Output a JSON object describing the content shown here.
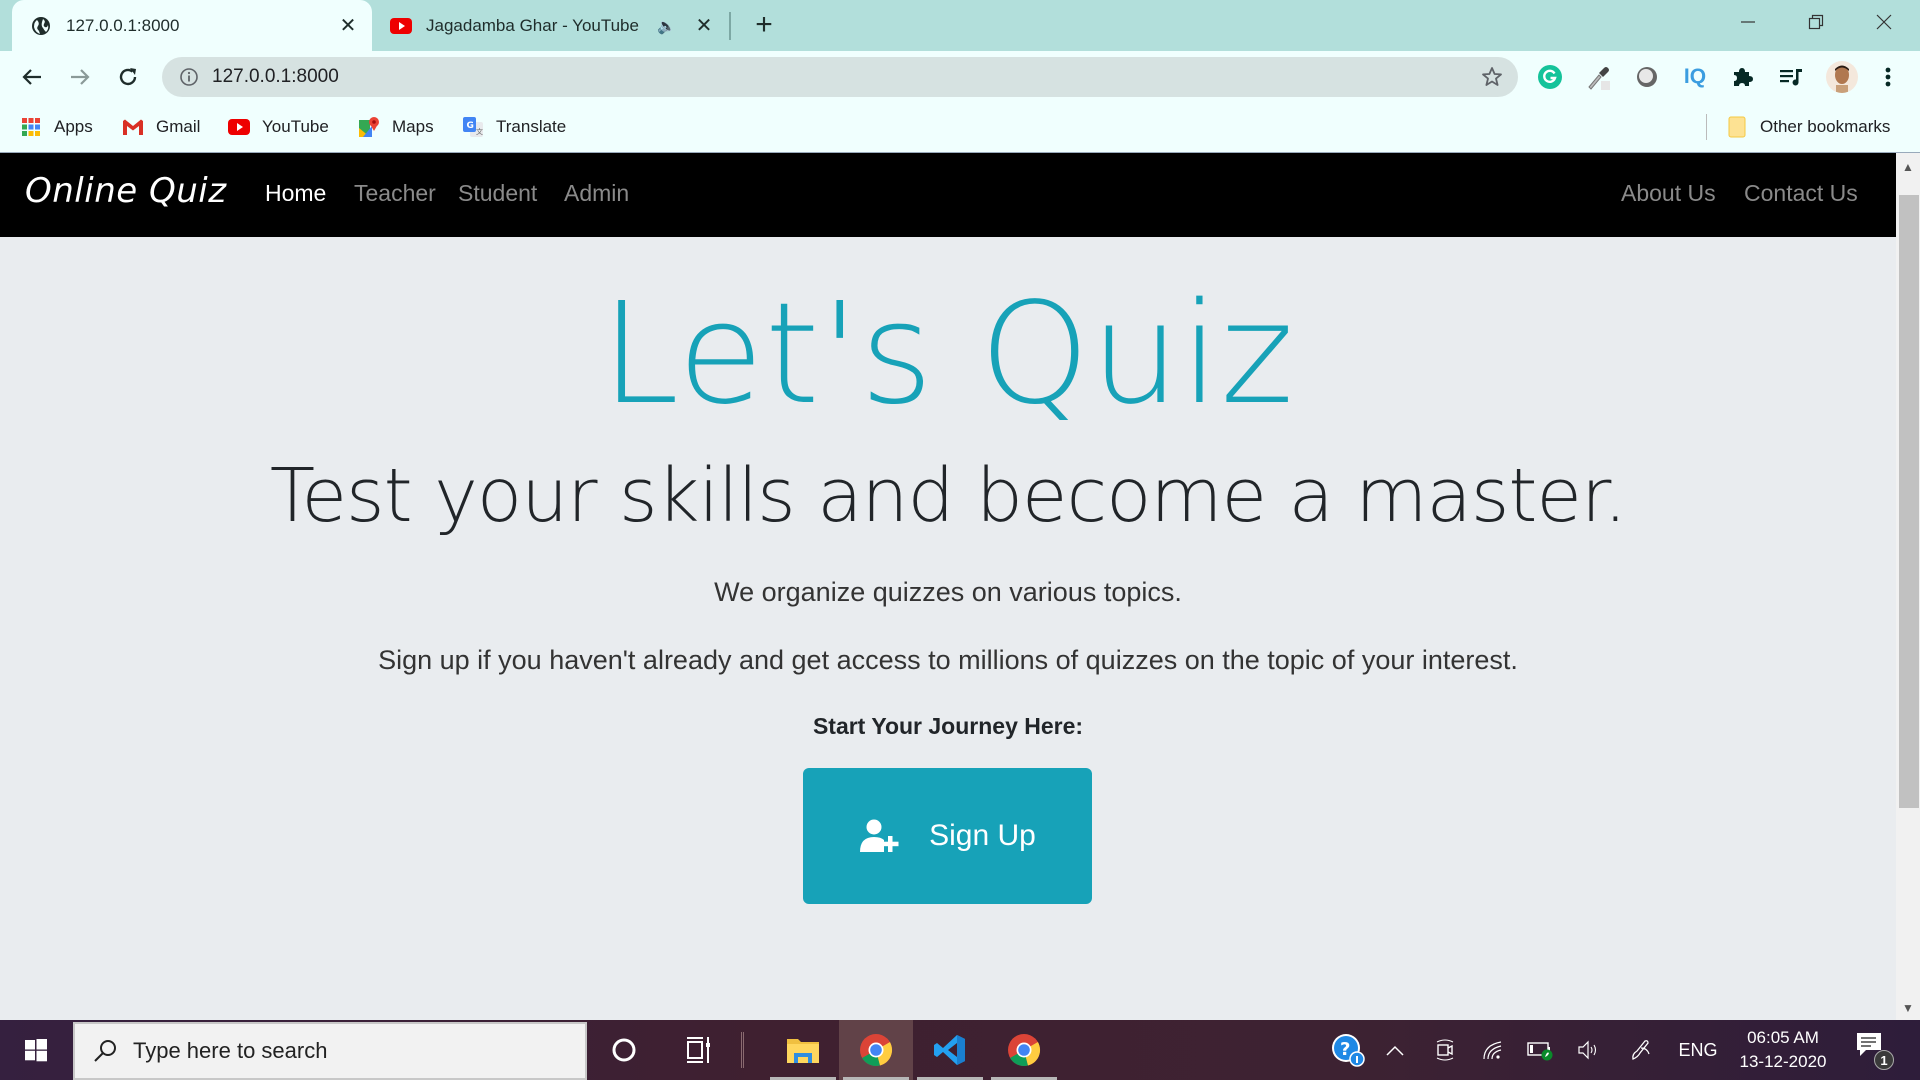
{
  "browser": {
    "tabs": [
      {
        "title": "127.0.0.1:8000",
        "icon": "globe-icon",
        "active": true
      },
      {
        "title": "Jagadamba Ghar - YouTube",
        "icon": "youtube-icon",
        "active": false,
        "audio": true
      }
    ],
    "new_tab_label": "+",
    "address_bar": {
      "url": "127.0.0.1:8000"
    },
    "extensions": [
      "grammarly-icon",
      "color-picker-icon",
      "dark-mode-icon",
      "iq-icon",
      "extensions-puzzle-icon",
      "media-control-icon",
      "profile-avatar",
      "menu-kebab-icon"
    ],
    "bookmarks": [
      {
        "label": "Apps",
        "icon": "apps-grid-icon"
      },
      {
        "label": "Gmail",
        "icon": "gmail-icon"
      },
      {
        "label": "YouTube",
        "icon": "youtube-icon"
      },
      {
        "label": "Maps",
        "icon": "maps-icon"
      },
      {
        "label": "Translate",
        "icon": "translate-icon"
      }
    ],
    "other_bookmarks": "Other bookmarks"
  },
  "site": {
    "brand": "Online Quiz",
    "nav_left": [
      {
        "label": "Home",
        "active": true
      },
      {
        "label": "Teacher",
        "active": false
      },
      {
        "label": "Student",
        "active": false
      },
      {
        "label": "Admin",
        "active": false
      }
    ],
    "nav_right": [
      {
        "label": "About Us"
      },
      {
        "label": "Contact Us"
      }
    ],
    "hero": {
      "title": "Let's Quiz",
      "subtitle": "Test your skills and become a master.",
      "lead1": "We organize quizzes on various topics.",
      "lead2": "Sign up if you haven't already and get access to millions of quizzes on the topic of your interest.",
      "journey": "Start Your Journey Here:",
      "signup_label": "Sign Up"
    },
    "colors": {
      "accent": "#17a2b8",
      "navbar": "#000000",
      "background": "#e9ecef"
    }
  },
  "taskbar": {
    "search_placeholder": "Type here to search",
    "apps": [
      "cortana-icon",
      "task-view-icon",
      "file-explorer-icon",
      "chrome-icon",
      "vscode-icon",
      "chrome-icon"
    ],
    "language": "ENG",
    "time": "06:05 AM",
    "date": "13-12-2020",
    "notification_count": "1"
  }
}
